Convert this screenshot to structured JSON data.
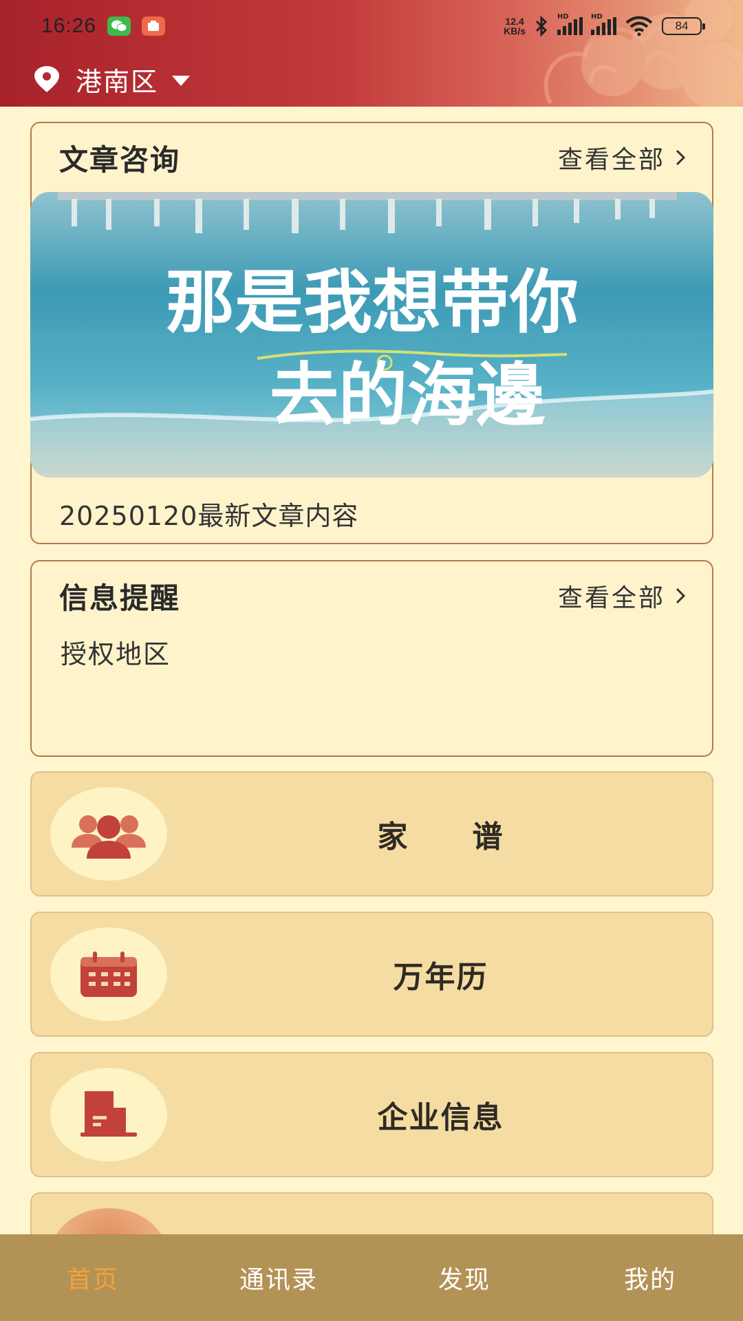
{
  "status_bar": {
    "time": "16:26",
    "net_speed_value": "12.4",
    "net_speed_unit": "KB/s",
    "sim1_label": "HD",
    "sim2_label": "HD",
    "battery": "84"
  },
  "header": {
    "location": "港南区"
  },
  "article_card": {
    "title": "文章咨询",
    "view_all": "查看全部",
    "image_text_line1": "那是我想带你",
    "image_text_line2": "去的海邊",
    "caption": "20250120最新文章内容"
  },
  "info_card": {
    "title": "信息提醒",
    "view_all": "查看全部",
    "item": "授权地区"
  },
  "features": [
    {
      "label": "家　　谱",
      "icon": "family-group-icon"
    },
    {
      "label": "万年历",
      "icon": "calendar-icon"
    },
    {
      "label": "企业信息",
      "icon": "building-icon"
    }
  ],
  "bottom_nav": {
    "items": [
      "首页",
      "通讯录",
      "发现",
      "我的"
    ],
    "active_index": 0
  },
  "colors": {
    "header_red": "#a8222a",
    "page_bg": "#fff6cf",
    "card_border": "#b5794a",
    "feature_bg": "#f5dca2",
    "nav_bg": "#b39256",
    "nav_active": "#f2a23a",
    "icon_red": "#c0403a"
  }
}
